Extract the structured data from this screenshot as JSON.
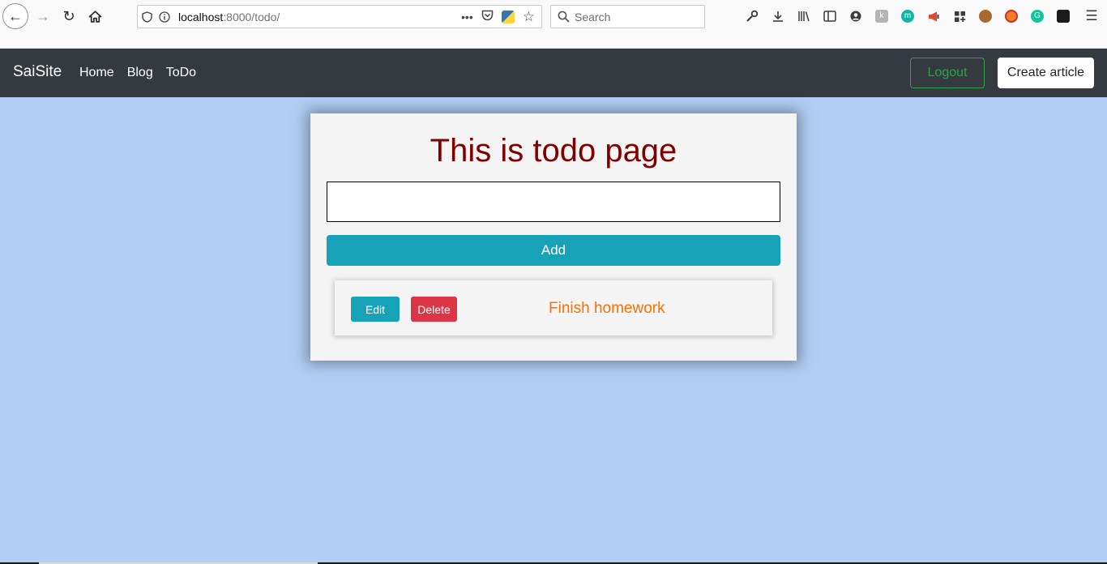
{
  "browser": {
    "url_host": "localhost",
    "url_path": ":8000/todo/",
    "search_placeholder": "Search"
  },
  "navbar": {
    "brand": "SaiSite",
    "links": [
      "Home",
      "Blog",
      "ToDo"
    ],
    "logout_label": "Logout",
    "create_label": "Create article"
  },
  "todo": {
    "title": "This is todo page",
    "input_value": "",
    "add_label": "Add",
    "items": [
      {
        "text": "Finish homework",
        "edit_label": "Edit",
        "delete_label": "Delete"
      }
    ]
  },
  "colors": {
    "background": "#b2cef5",
    "navbar": "#343a40",
    "title": "#800000",
    "info": "#17a2b8",
    "danger": "#dc3545",
    "success": "#28a745",
    "item_text": "#ff6f00"
  }
}
